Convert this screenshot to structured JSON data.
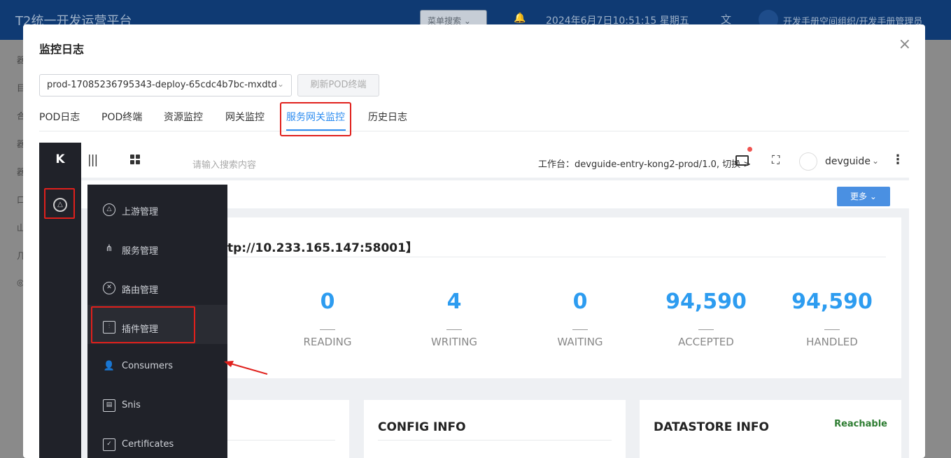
{
  "background": {
    "app_title": "T2统一开发运营平台",
    "menu_search": "菜单搜索",
    "datetime": "2024年6月7日10:51:15 星期五",
    "user": "开发手册空间组织/开发手册管理员"
  },
  "modal": {
    "title": "监控日志",
    "close": "×",
    "pod_select": "prod-17085236795343-deploy-65cdc4b7bc-mxdtd",
    "refresh_button": "刷新POD终端",
    "tabs": [
      "POD日志",
      "POD终端",
      "资源监控",
      "网关监控",
      "服务网关监控",
      "历史日志"
    ],
    "active_tab": "服务网关监控"
  },
  "kong": {
    "logo": "K",
    "search_placeholder": "请输入搜索内容",
    "workspace": "工作台：devguide-entry-kong2-prod/1.0, 切换",
    "username": "devguide",
    "more_button": "更多",
    "node_title": "tp://10.233.165.147:58001】",
    "stats": [
      {
        "value": "0",
        "label": "READING"
      },
      {
        "value": "4",
        "label": "WRITING"
      },
      {
        "value": "0",
        "label": "WAITING"
      },
      {
        "value": "94,590",
        "label": "ACCEPTED"
      },
      {
        "value": "94,590",
        "label": "HANDLED"
      }
    ],
    "config_info": "CONFIG INFO",
    "datastore_info": "DATASTORE INFO",
    "reachable": "Reachable",
    "menu": [
      {
        "label": "上游管理",
        "icon": "upstream-icon"
      },
      {
        "label": "服务管理",
        "icon": "hierarchy-icon"
      },
      {
        "label": "路由管理",
        "icon": "route-icon"
      },
      {
        "label": "插件管理",
        "icon": "sliders-icon"
      },
      {
        "label": "Consumers",
        "icon": "user-icon"
      },
      {
        "label": "Snis",
        "icon": "id-card-icon"
      },
      {
        "label": "Certificates",
        "icon": "certificate-icon"
      }
    ]
  },
  "colors": {
    "accent": "#2d8cf0",
    "highlight": "#e0201c",
    "sidebar": "#202229",
    "stat": "#2d9cf0",
    "reachable": "#2e7d32"
  }
}
